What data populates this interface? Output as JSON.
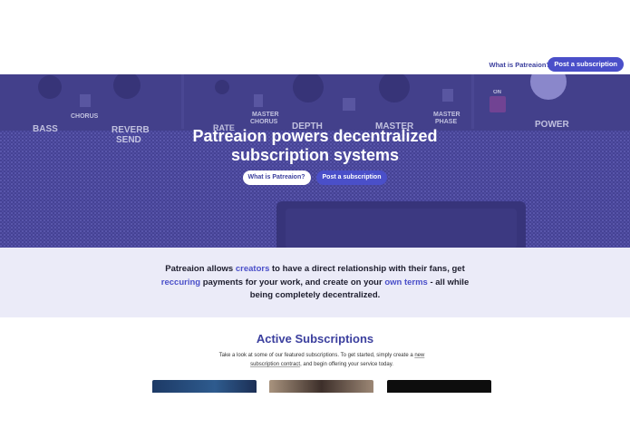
{
  "nav": {
    "what_link": "What is Patreaion?",
    "post_button": "Post a subscription"
  },
  "hero": {
    "title_line1": "Patreaion powers decentralized",
    "title_line2": "subscription systems",
    "what_button": "What is Patreaion?",
    "post_button": "Post a subscription",
    "amp_labels": [
      "BASS",
      "CHORUS",
      "REVERB",
      "SEND",
      "RATE",
      "MASTER",
      "CHORUS",
      "DEPTH",
      "MASTER",
      "MASTER",
      "PHASE",
      "ON",
      "POWER"
    ]
  },
  "about": {
    "part1": "Patreaion allows ",
    "link1": "creators",
    "part2": " to have a direct relationship with their fans, get ",
    "link2": "reccuring",
    "part3": " payments for your work, and create on your ",
    "link3": "own terms",
    "part4": " - all while being completely decentralized."
  },
  "subscriptions": {
    "title": "Active Subscriptions",
    "desc1": "Take a look at some of our featured subscriptions. To get started, simply create a ",
    "desc_link": "new subscription contract",
    "desc2": ", and begin offering your service today."
  },
  "colors": {
    "accent": "#4a4fc9",
    "accent_dark": "#3b3f9e",
    "about_bg": "#ebebf8"
  }
}
